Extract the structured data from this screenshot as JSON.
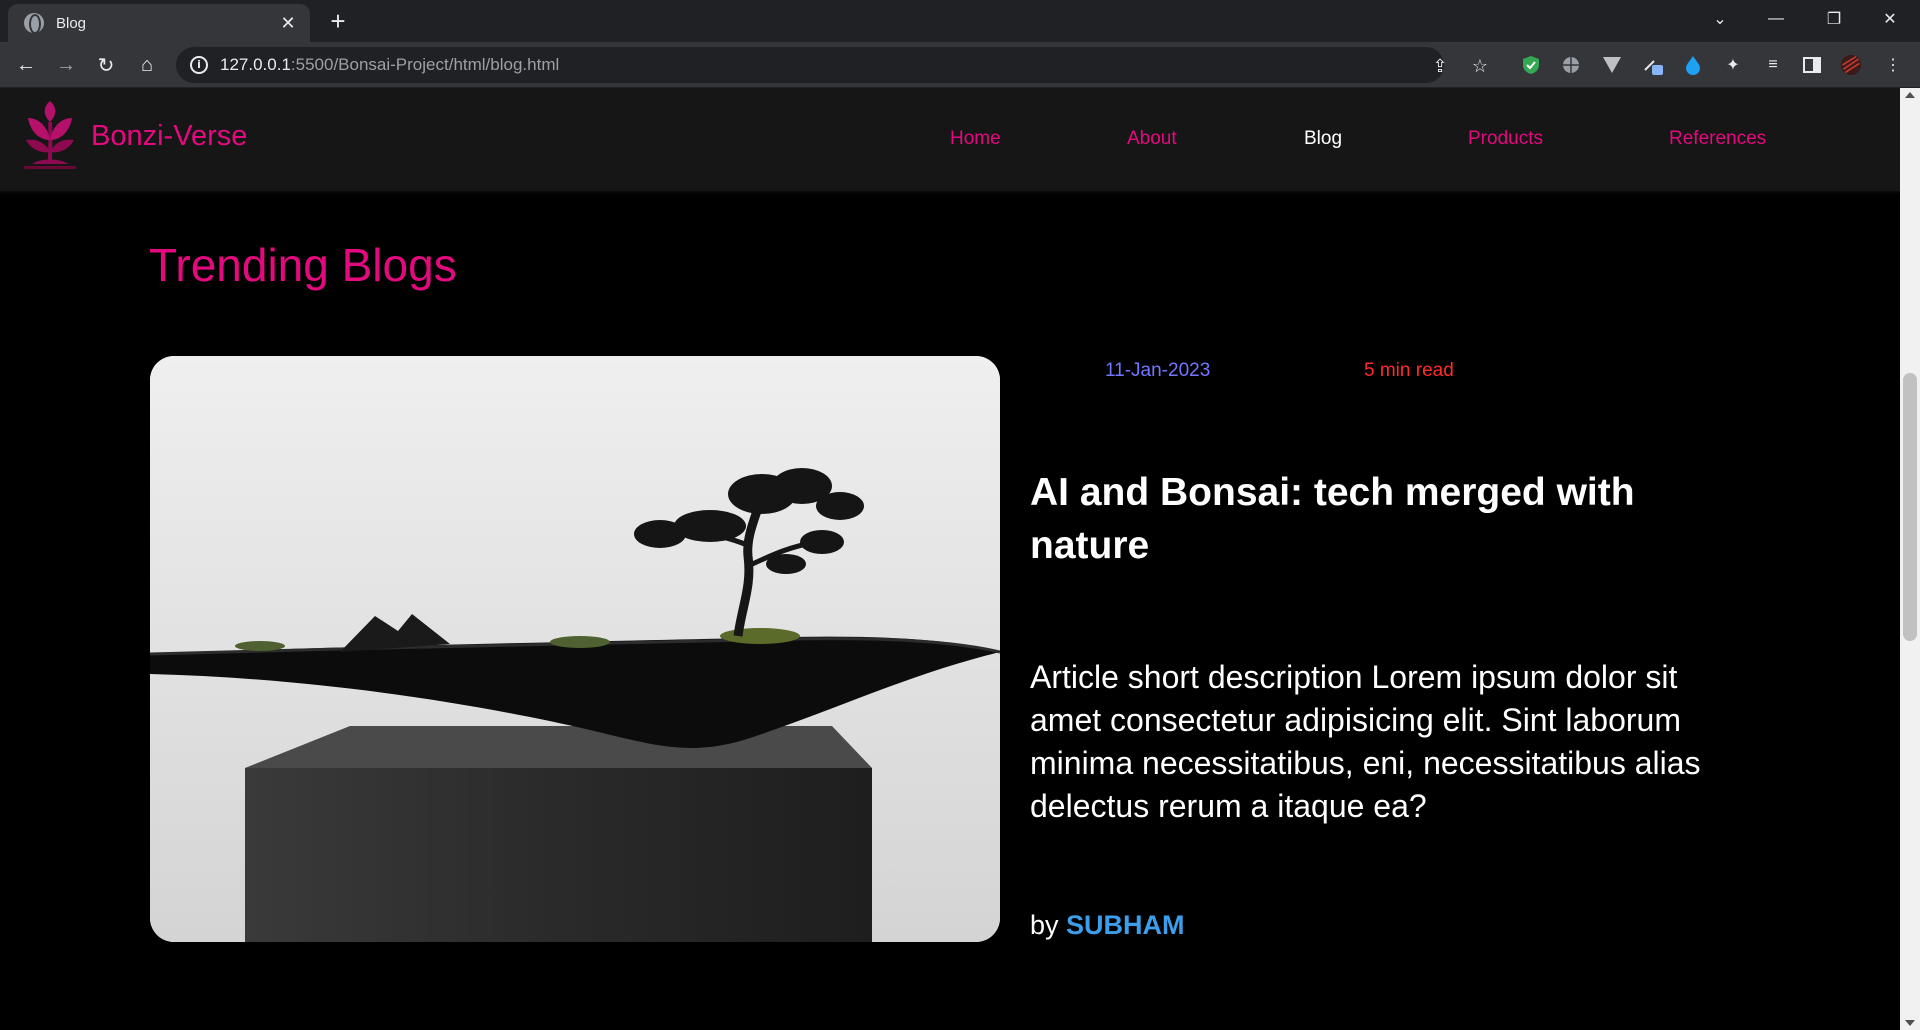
{
  "browser": {
    "tab_title": "Blog",
    "url_host": "127.0.0.1",
    "url_path": ":5500/Bonsai-Project/html/blog.html"
  },
  "site": {
    "brand": "Bonzi-Verse",
    "nav": [
      {
        "label": "Home",
        "active": false
      },
      {
        "label": "About",
        "active": false
      },
      {
        "label": "Blog",
        "active": true
      },
      {
        "label": "Products",
        "active": false
      },
      {
        "label": "References",
        "active": false
      }
    ],
    "accent_color": "#e5097f"
  },
  "main": {
    "section_title": "Trending Blogs",
    "blog": {
      "date": "11-Jan-2023",
      "read_time": "5 min read",
      "title": "AI and Bonsai: tech merged with nature",
      "description": "Article short description Lorem ipsum dolor sit amet consectetur adipisicing elit. Sint laborum minima necessitatibus, eni, necessitatibus alias delectus rerum a itaque ea?",
      "by": "by",
      "author": "SUBHAM",
      "image_alt": "bonsai-on-black-pot"
    }
  }
}
